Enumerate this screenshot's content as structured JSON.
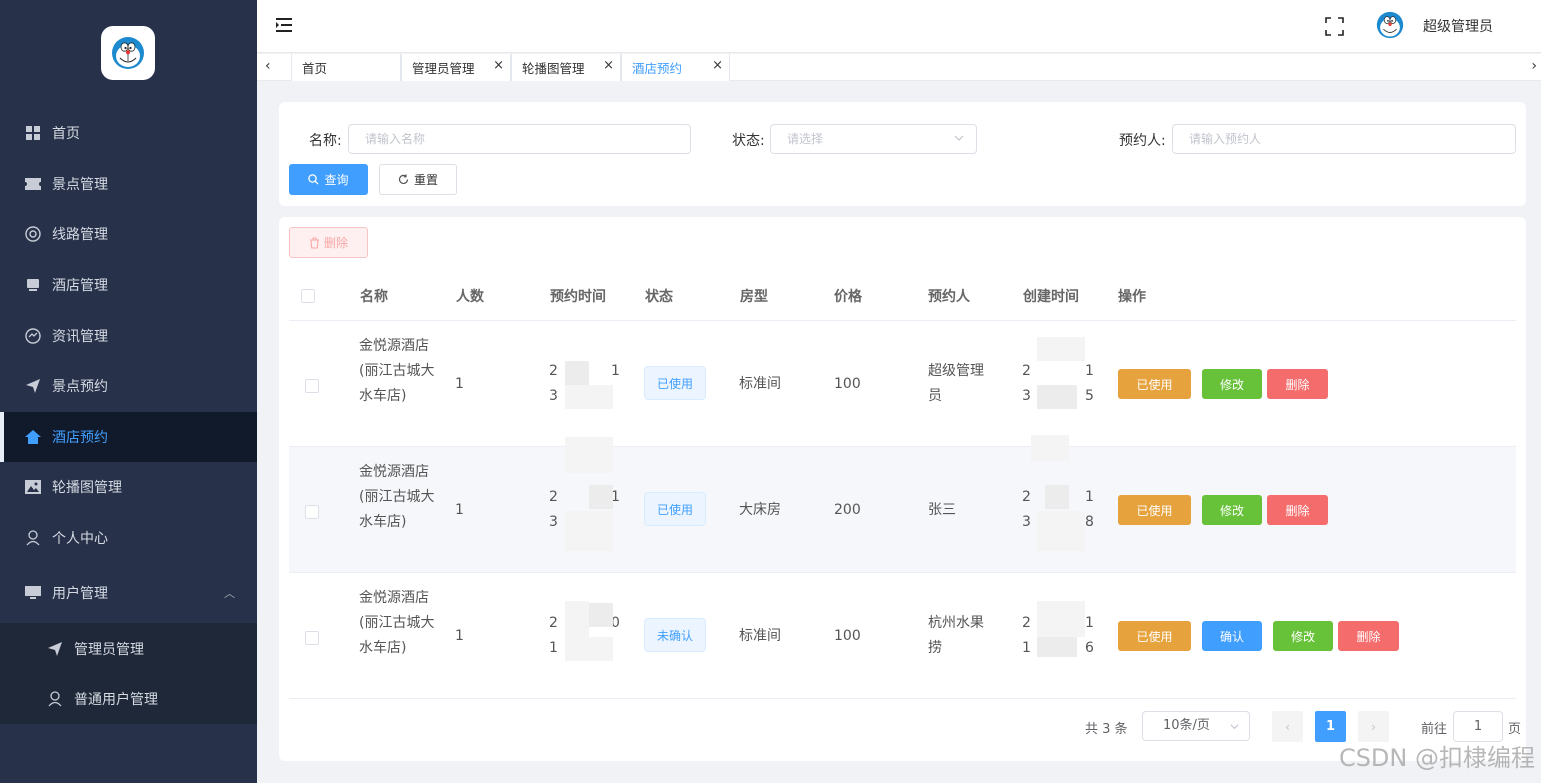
{
  "sidebar": {
    "items": [
      {
        "label": "首页",
        "icon": "grid-icon"
      },
      {
        "label": "景点管理",
        "icon": "ticket-icon"
      },
      {
        "label": "线路管理",
        "icon": "lifebuoy-icon"
      },
      {
        "label": "酒店管理",
        "icon": "hotel-icon"
      },
      {
        "label": "资讯管理",
        "icon": "news-icon"
      },
      {
        "label": "景点预约",
        "icon": "paper-plane-icon"
      },
      {
        "label": "酒店预约",
        "icon": "home-icon"
      },
      {
        "label": "轮播图管理",
        "icon": "picture-icon"
      },
      {
        "label": "个人中心",
        "icon": "user-icon"
      }
    ],
    "group": {
      "label": "用户管理",
      "icon": "monitor-icon",
      "children": [
        {
          "label": "管理员管理",
          "icon": "paper-plane-icon"
        },
        {
          "label": "普通用户管理",
          "icon": "user-icon"
        }
      ]
    }
  },
  "header": {
    "username": "超级管理员"
  },
  "tabs": [
    {
      "label": "首页"
    },
    {
      "label": "管理员管理"
    },
    {
      "label": "轮播图管理"
    },
    {
      "label": "酒店预约"
    }
  ],
  "search": {
    "name_label": "名称:",
    "name_placeholder": "请输入名称",
    "status_label": "状态:",
    "status_placeholder": "请选择",
    "booker_label": "预约人:",
    "booker_placeholder": "请输入预约人",
    "query_label": "查询",
    "reset_label": "重置"
  },
  "table": {
    "batch_delete_label": "删除",
    "columns": [
      "名称",
      "人数",
      "预约时间",
      "状态",
      "房型",
      "价格",
      "预约人",
      "创建时间",
      "操作"
    ],
    "rows": [
      {
        "name": "金悦源酒店(丽江古城大水车店)",
        "people": "1",
        "book_time_a": "2",
        "book_time_b": "1",
        "book_time_c": "3",
        "status": "已使用",
        "room": "标准间",
        "price": "100",
        "booker": "超级管理员",
        "created_a": "2",
        "created_b": "1",
        "created_c": "3",
        "created_d": "5",
        "actions": [
          "已使用",
          "修改",
          "删除"
        ]
      },
      {
        "name": "金悦源酒店(丽江古城大水车店)",
        "people": "1",
        "book_time_a": "2",
        "book_time_b": "1",
        "book_time_c": "3",
        "status": "已使用",
        "room": "大床房",
        "price": "200",
        "booker": "张三",
        "created_a": "2",
        "created_b": "1",
        "created_c": "3",
        "created_d": "8",
        "actions": [
          "已使用",
          "修改",
          "删除"
        ]
      },
      {
        "name": "金悦源酒店(丽江古城大水车店)",
        "people": "1",
        "book_time_a": "2",
        "book_time_b": "0",
        "book_time_c": "1",
        "status": "未确认",
        "room": "标准间",
        "price": "100",
        "booker": "杭州水果捞",
        "created_a": "2",
        "created_b": "1",
        "created_c": "1",
        "created_d": "6",
        "actions": [
          "已使用",
          "确认",
          "修改",
          "删除"
        ]
      }
    ]
  },
  "pagination": {
    "total": "共 3 条",
    "page_size": "10条/页",
    "current": "1",
    "goto_label": "前往",
    "goto_value": "1",
    "page_label": "页"
  },
  "watermark": "CSDN @扣棣编程",
  "colors": {
    "sidebar_bg": "#27324a",
    "accent": "#409eff",
    "warning": "#e6a23c",
    "success": "#67c23a",
    "danger": "#f56c6c"
  }
}
